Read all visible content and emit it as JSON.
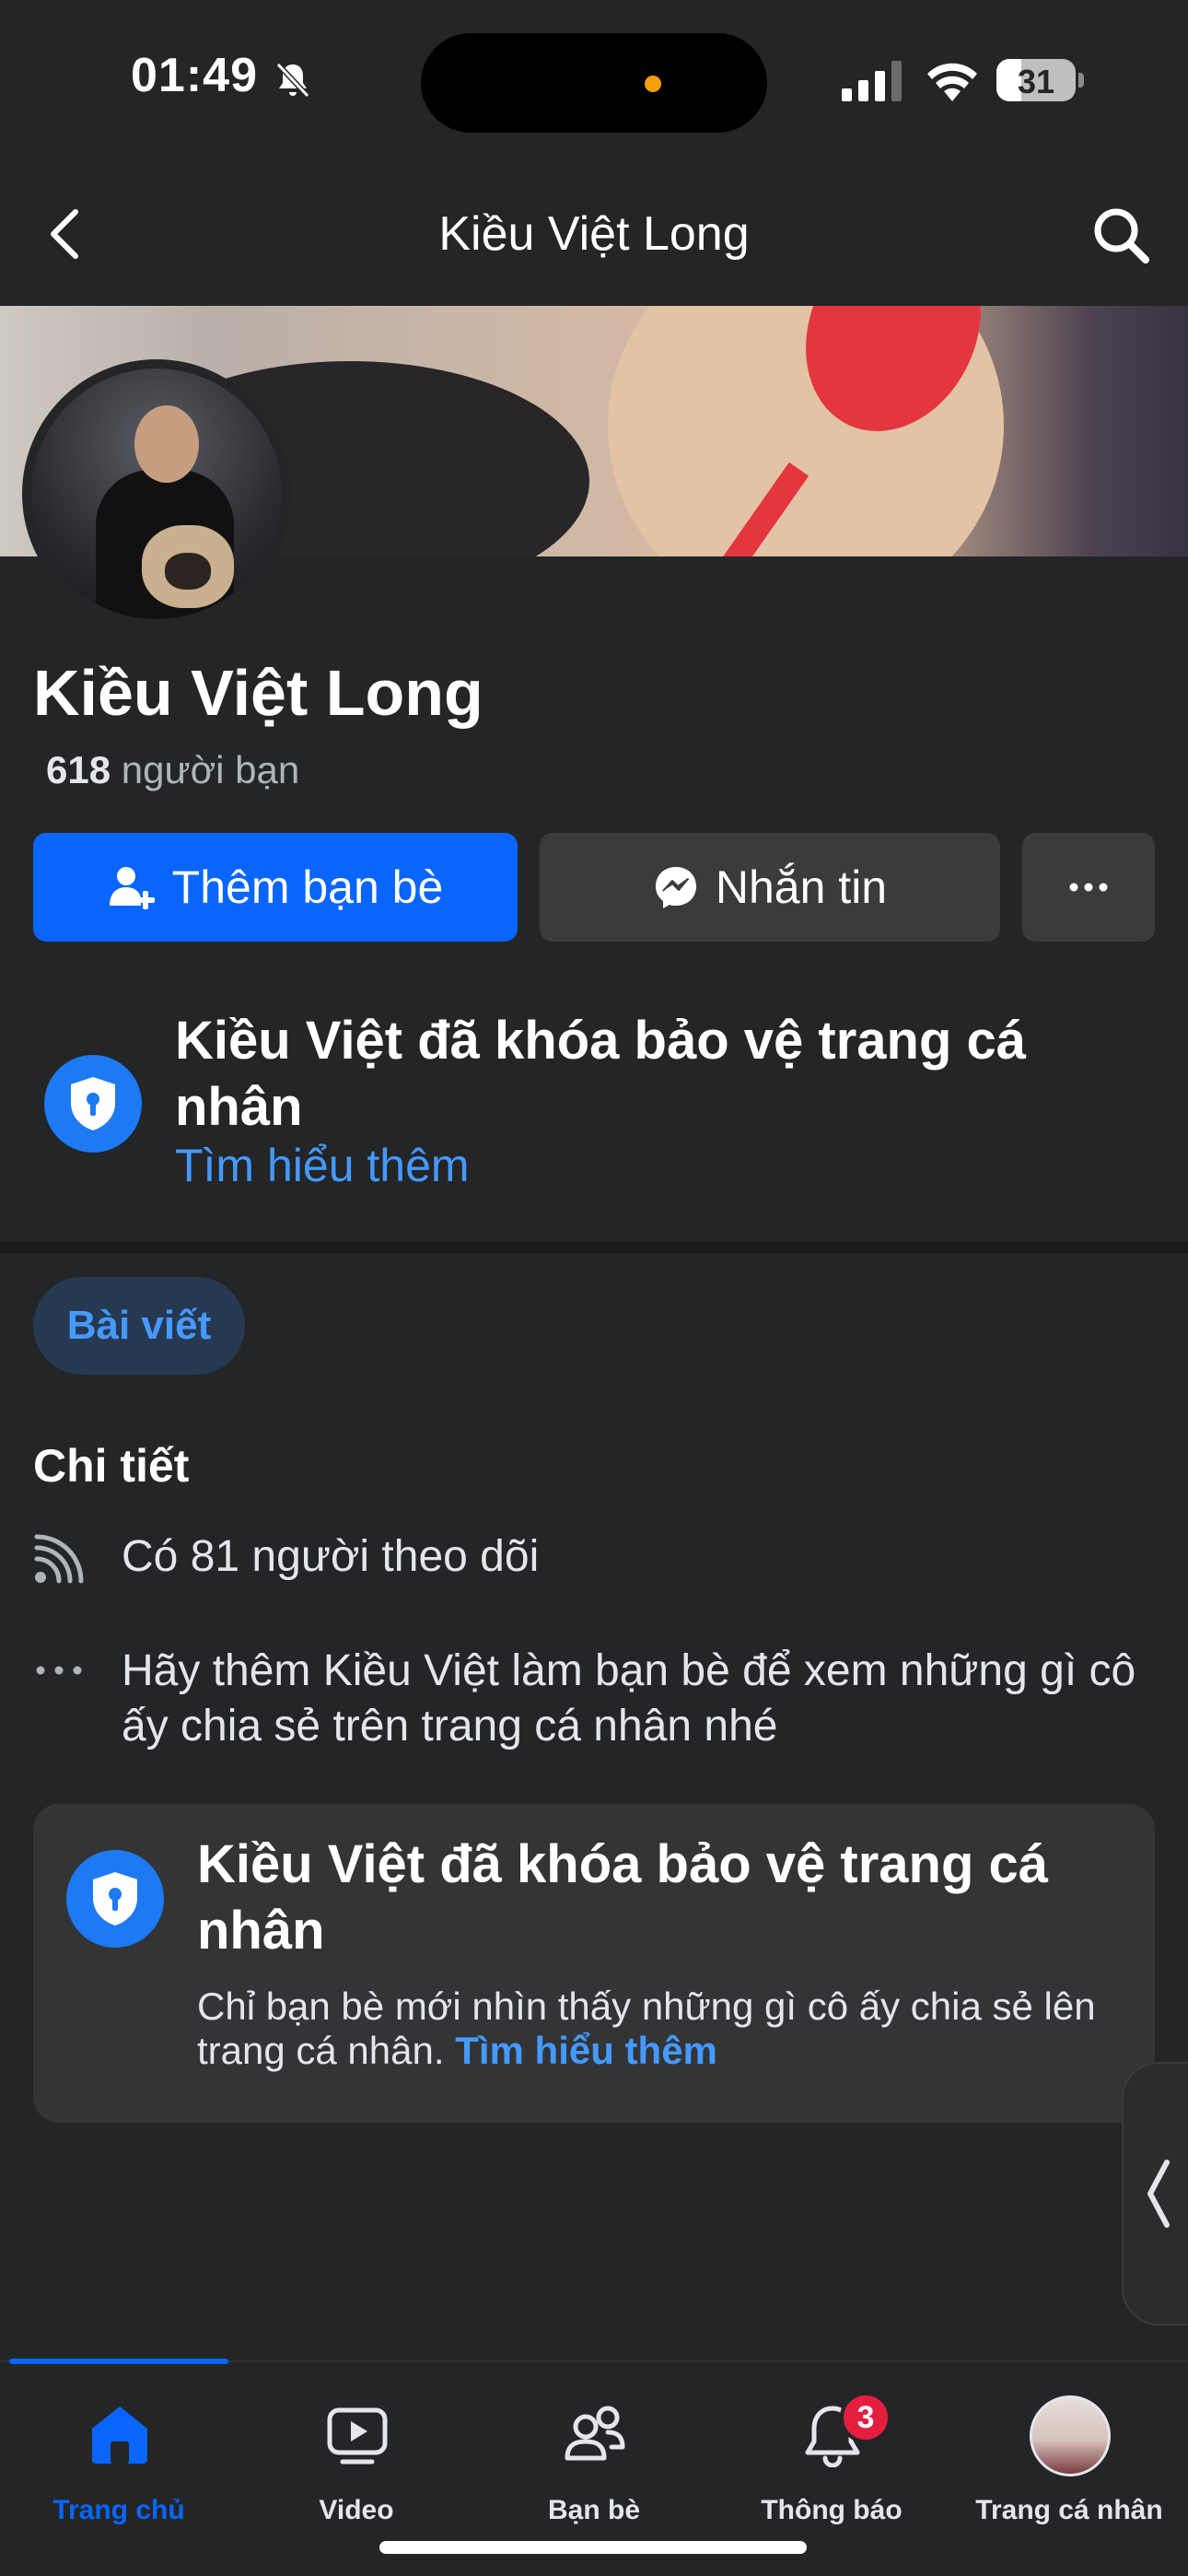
{
  "status_bar": {
    "time": "01:49",
    "battery": "31"
  },
  "nav": {
    "title": "Kiều Việt Long"
  },
  "profile": {
    "name": "Kiều Việt Long",
    "friends_count": "618",
    "friends_label": "người bạn"
  },
  "actions": {
    "add_friend": "Thêm bạn bè",
    "message": "Nhắn tin",
    "more": "..."
  },
  "lock_notice": {
    "title": "Kiều Việt đã khóa bảo vệ trang cá nhân",
    "link": "Tìm hiểu thêm"
  },
  "tabs": {
    "posts": "Bài viết"
  },
  "details": {
    "heading": "Chi tiết",
    "followers": "Có 81 người theo dõi",
    "add_friend_hint": "Hãy thêm Kiều Việt làm bạn bè để xem những gì cô ấy chia sẻ trên trang cá nhân nhé"
  },
  "lock_card": {
    "title": "Kiều Việt đã khóa bảo vệ trang cá nhân",
    "desc": "Chỉ bạn bè mới nhìn thấy những gì cô ấy chia sẻ lên trang cá nhân. ",
    "link": "Tìm hiểu thêm"
  },
  "tabbar": {
    "home": "Trang chủ",
    "video": "Video",
    "friends": "Bạn bè",
    "notifications": "Thông báo",
    "notifications_badge": "3",
    "profile": "Trang cá nhân"
  },
  "colors": {
    "background": "#242527",
    "primary": "#0866ff",
    "link": "#4599ff",
    "badge": "#e41e3f"
  }
}
